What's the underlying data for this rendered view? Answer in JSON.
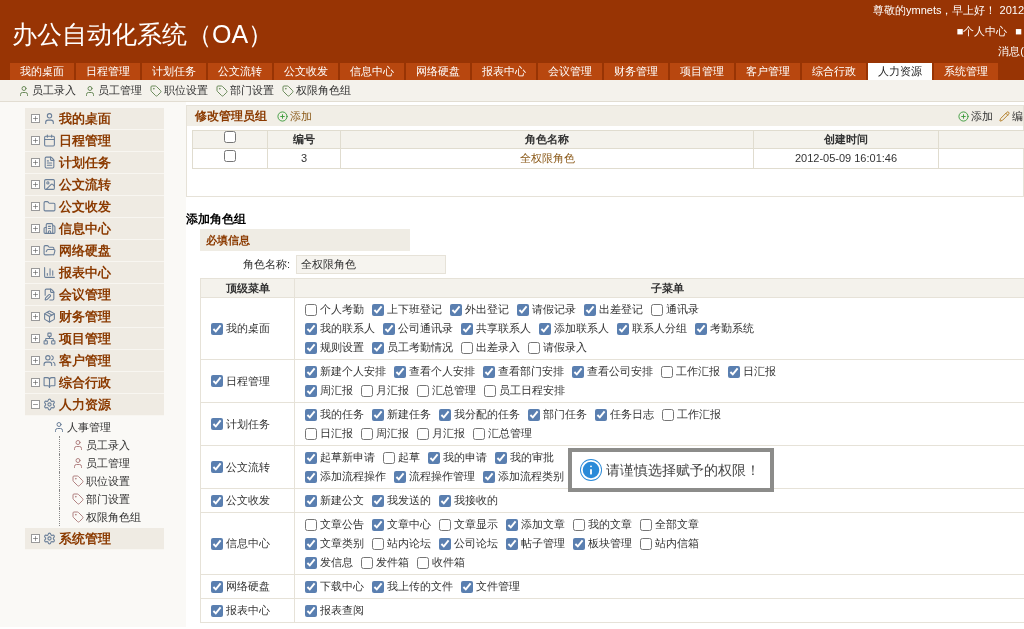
{
  "header": {
    "title": "办公自动化系统（OA）",
    "greeting": "尊敬的ymnets，早上好！ 2012",
    "links": [
      "■个人中心",
      "■"
    ],
    "message": "消息("
  },
  "tabs": [
    {
      "label": "我的桌面",
      "selected": false
    },
    {
      "label": "日程管理",
      "selected": false
    },
    {
      "label": "计划任务",
      "selected": false
    },
    {
      "label": "公文流转",
      "selected": false
    },
    {
      "label": "公文收发",
      "selected": false
    },
    {
      "label": "信息中心",
      "selected": false
    },
    {
      "label": "网络硬盘",
      "selected": false
    },
    {
      "label": "报表中心",
      "selected": false
    },
    {
      "label": "会议管理",
      "selected": false
    },
    {
      "label": "财务管理",
      "selected": false
    },
    {
      "label": "项目管理",
      "selected": false
    },
    {
      "label": "客户管理",
      "selected": false
    },
    {
      "label": "综合行政",
      "selected": false
    },
    {
      "label": "人力资源",
      "selected": true
    },
    {
      "label": "系统管理",
      "selected": false
    }
  ],
  "subnav": [
    "员工录入",
    "员工管理",
    "职位设置",
    "部门设置",
    "权限角色组"
  ],
  "sidebar": {
    "items": [
      {
        "label": "我的桌面",
        "expanded": false
      },
      {
        "label": "日程管理",
        "expanded": false
      },
      {
        "label": "计划任务",
        "expanded": false
      },
      {
        "label": "公文流转",
        "expanded": false
      },
      {
        "label": "公文收发",
        "expanded": false
      },
      {
        "label": "信息中心",
        "expanded": false
      },
      {
        "label": "网络硬盘",
        "expanded": false
      },
      {
        "label": "报表中心",
        "expanded": false
      },
      {
        "label": "会议管理",
        "expanded": false
      },
      {
        "label": "财务管理",
        "expanded": false
      },
      {
        "label": "项目管理",
        "expanded": false
      },
      {
        "label": "客户管理",
        "expanded": false
      },
      {
        "label": "综合行政",
        "expanded": false
      },
      {
        "label": "人力资源",
        "expanded": true,
        "children": [
          {
            "label": "人事管理",
            "children": [
              {
                "label": "员工录入"
              },
              {
                "label": "员工管理"
              },
              {
                "label": "职位设置"
              },
              {
                "label": "部门设置"
              },
              {
                "label": "权限角色组"
              }
            ]
          }
        ]
      },
      {
        "label": "系统管理",
        "expanded": false
      }
    ]
  },
  "admin_panel": {
    "title": "修改管理员组",
    "add": "添加",
    "right_actions": [
      "添加",
      "编"
    ],
    "columns": [
      "编号",
      "角色名称",
      "创建时间"
    ],
    "header_checked": false,
    "rows": [
      {
        "checked": false,
        "id": "3",
        "name": "全权限角色",
        "created": "2012-05-09 16:01:46"
      }
    ]
  },
  "form": {
    "title": "添加角色组",
    "section": "必填信息",
    "field_label": "角色名称:",
    "field_value": "全权限角色",
    "columns": [
      "顶级菜单",
      "子菜单"
    ],
    "rows": [
      {
        "name": "我的桌面",
        "checked": true,
        "lines": [
          [
            {
              "label": "个人考勤",
              "checked": false
            },
            {
              "label": "上下班登记",
              "checked": true
            },
            {
              "label": "外出登记",
              "checked": true
            },
            {
              "label": "请假记录",
              "checked": true
            },
            {
              "label": "出差登记",
              "checked": true
            },
            {
              "label": "通讯录",
              "checked": false
            }
          ],
          [
            {
              "label": "我的联系人",
              "checked": true
            },
            {
              "label": "公司通讯录",
              "checked": true
            },
            {
              "label": "共享联系人",
              "checked": true
            },
            {
              "label": "添加联系人",
              "checked": true
            },
            {
              "label": "联系人分组",
              "checked": true
            },
            {
              "label": "考勤系统",
              "checked": true
            }
          ],
          [
            {
              "label": "规则设置",
              "checked": true
            },
            {
              "label": "员工考勤情况",
              "checked": true
            },
            {
              "label": "出差录入",
              "checked": false
            },
            {
              "label": "请假录入",
              "checked": false
            }
          ]
        ]
      },
      {
        "name": "日程管理",
        "checked": true,
        "lines": [
          [
            {
              "label": "新建个人安排",
              "checked": true
            },
            {
              "label": "查看个人安排",
              "checked": true
            },
            {
              "label": "查看部门安排",
              "checked": true
            },
            {
              "label": "查看公司安排",
              "checked": true
            },
            {
              "label": "工作汇报",
              "checked": false
            },
            {
              "label": "日汇报",
              "checked": true
            }
          ],
          [
            {
              "label": "周汇报",
              "checked": true
            },
            {
              "label": "月汇报",
              "checked": false
            },
            {
              "label": "汇总管理",
              "checked": false
            },
            {
              "label": "员工日程安排",
              "checked": false
            }
          ]
        ]
      },
      {
        "name": "计划任务",
        "checked": true,
        "lines": [
          [
            {
              "label": "我的任务",
              "checked": true
            },
            {
              "label": "新建任务",
              "checked": true
            },
            {
              "label": "我分配的任务",
              "checked": true
            },
            {
              "label": "部门任务",
              "checked": true
            },
            {
              "label": "任务日志",
              "checked": true
            },
            {
              "label": "工作汇报",
              "checked": false
            }
          ],
          [
            {
              "label": "日汇报",
              "checked": false
            },
            {
              "label": "周汇报",
              "checked": false
            },
            {
              "label": "月汇报",
              "checked": false
            },
            {
              "label": "汇总管理",
              "checked": false
            }
          ]
        ]
      },
      {
        "name": "公文流转",
        "checked": true,
        "lines": [
          [
            {
              "label": "起草新申请",
              "checked": true
            },
            {
              "label": "起草",
              "checked": false
            },
            {
              "label": "我的申请",
              "checked": true
            },
            {
              "label": "我的审批",
              "checked": true
            }
          ],
          [
            {
              "label": "添加流程操作",
              "checked": true
            },
            {
              "label": "流程操作管理",
              "checked": true
            },
            {
              "label": "添加流程类别",
              "checked": true
            }
          ]
        ]
      },
      {
        "name": "公文收发",
        "checked": true,
        "lines": [
          [
            {
              "label": "新建公文",
              "checked": true
            },
            {
              "label": "我发送的",
              "checked": true
            },
            {
              "label": "我接收的",
              "checked": true
            }
          ]
        ]
      },
      {
        "name": "信息中心",
        "checked": true,
        "lines": [
          [
            {
              "label": "文章公告",
              "checked": false
            },
            {
              "label": "文章中心",
              "checked": true
            },
            {
              "label": "文章显示",
              "checked": false
            },
            {
              "label": "添加文章",
              "checked": true
            },
            {
              "label": "我的文章",
              "checked": false
            },
            {
              "label": "全部文章",
              "checked": false
            }
          ],
          [
            {
              "label": "文章类别",
              "checked": true
            },
            {
              "label": "站内论坛",
              "checked": false
            },
            {
              "label": "公司论坛",
              "checked": true
            },
            {
              "label": "帖子管理",
              "checked": true
            },
            {
              "label": "板块管理",
              "checked": true
            },
            {
              "label": "站内信箱",
              "checked": false
            }
          ],
          [
            {
              "label": "发信息",
              "checked": true
            },
            {
              "label": "发件箱",
              "checked": false
            },
            {
              "label": "收件箱",
              "checked": false
            }
          ]
        ]
      },
      {
        "name": "网络硬盘",
        "checked": true,
        "lines": [
          [
            {
              "label": "下载中心",
              "checked": true
            },
            {
              "label": "我上传的文件",
              "checked": true
            },
            {
              "label": "文件管理",
              "checked": true
            }
          ]
        ]
      },
      {
        "name": "报表中心",
        "checked": true,
        "lines": [
          [
            {
              "label": "报表查阅",
              "checked": true
            }
          ]
        ]
      }
    ]
  },
  "notice": "请谨慎选择赋予的权限！"
}
